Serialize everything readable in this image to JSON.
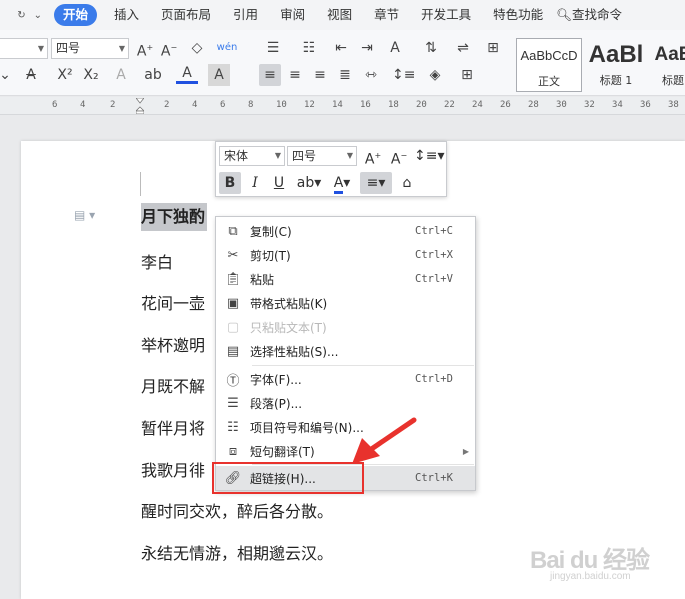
{
  "menubar": {
    "tabs": [
      {
        "label": "开始",
        "active": true
      },
      {
        "label": "插入"
      },
      {
        "label": "页面布局"
      },
      {
        "label": "引用"
      },
      {
        "label": "审阅"
      },
      {
        "label": "视图"
      },
      {
        "label": "章节"
      },
      {
        "label": "开发工具"
      },
      {
        "label": "特色功能"
      }
    ],
    "search_label": "查找命令"
  },
  "ribbon": {
    "font_size_value": "四号",
    "styles": [
      {
        "sample": "AaBbCcD",
        "name": "正文"
      },
      {
        "sample": "AaBl",
        "name": "标题 1"
      },
      {
        "sample": "AaE",
        "name": "标题"
      }
    ]
  },
  "ruler": {
    "numbers": [
      "6",
      "4",
      "2",
      "2",
      "4",
      "6",
      "8",
      "10",
      "12",
      "14",
      "16",
      "18",
      "20",
      "22",
      "24",
      "26",
      "28",
      "30",
      "32",
      "34",
      "36",
      "38"
    ]
  },
  "mini_toolbar": {
    "font_name": "宋体",
    "font_size": "四号"
  },
  "document": {
    "title": "月下独酌",
    "lines": [
      "李白",
      "花间一壶",
      "举杯邀明",
      "月既不解",
      "暂伴月将",
      "我歌月徘",
      "醒时同交欢，醉后各分散。",
      "永结无情游，相期邈云汉。"
    ]
  },
  "context_menu": {
    "items": [
      {
        "label": "复制(C)",
        "shortcut": "Ctrl+C",
        "icon": "copy-icon"
      },
      {
        "label": "剪切(T)",
        "shortcut": "Ctrl+X",
        "icon": "scissors-icon"
      },
      {
        "label": "粘贴",
        "shortcut": "Ctrl+V",
        "icon": "paste-icon"
      },
      {
        "label": "带格式粘贴(K)",
        "shortcut": "",
        "icon": "paste-format-icon"
      },
      {
        "label": "只粘贴文本(T)",
        "shortcut": "",
        "icon": "paste-text-icon",
        "disabled": true
      },
      {
        "label": "选择性粘贴(S)...",
        "shortcut": "",
        "icon": "paste-special-icon"
      },
      {
        "label": "字体(F)...",
        "shortcut": "Ctrl+D",
        "icon": "font-icon"
      },
      {
        "label": "段落(P)...",
        "shortcut": "",
        "icon": "paragraph-icon"
      },
      {
        "label": "项目符号和编号(N)...",
        "shortcut": "",
        "icon": "list-icon"
      },
      {
        "label": "短句翻译(T)",
        "shortcut": "",
        "icon": "translate-icon",
        "submenu": true
      },
      {
        "label": "超链接(H)...",
        "shortcut": "Ctrl+K",
        "icon": "link-icon",
        "highlighted": true
      }
    ]
  },
  "watermark": {
    "big": "Bai du 经验",
    "small": "jingyan.baidu.com"
  },
  "colors": {
    "accent": "#3a7bea",
    "annotation": "#e8322d",
    "font_color_bar": "#2051e0",
    "strike_color_bar": "#e02020"
  }
}
